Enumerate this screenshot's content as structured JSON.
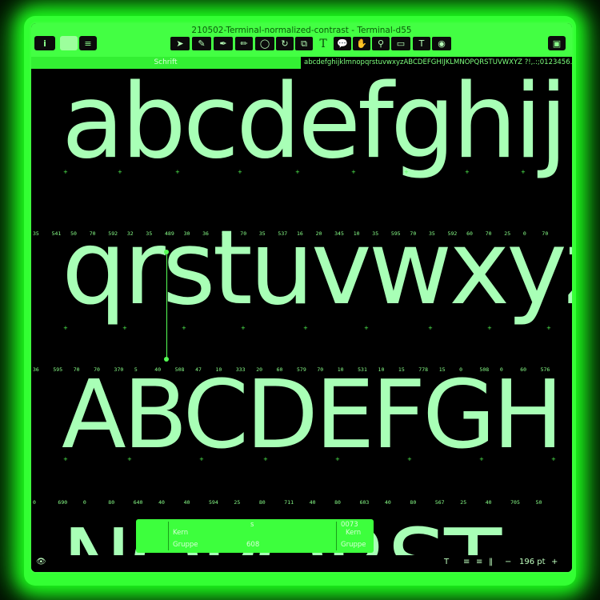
{
  "window": {
    "title": "210502-Terminal-normalized-contrast - Terminal-d55"
  },
  "toolbar": {
    "info_label": "i",
    "list_icon": "list-icon",
    "tools": [
      "pointer-icon",
      "eraser-icon",
      "pen-icon",
      "pencil-icon",
      "circle-icon",
      "rotate-icon",
      "scale-icon",
      "text-tool-icon",
      "speech-bubble-icon",
      "hand-icon",
      "magnifier-icon",
      "measure-icon",
      "tt-icon",
      "annotate-icon"
    ],
    "text_tool_label": "T",
    "sidebar_toggle_icon": "sidebar-icon"
  },
  "tabs": {
    "left_label": "Schrift",
    "right_label": "abcdefghijklmnopqrstuvwxyzABCDEFGHIJKLMNOPQRSTUVWXYZ ?!,.:;0123456..."
  },
  "canvas": {
    "line1": "abcdefghij",
    "line2": "qrstuvwxyz",
    "line3": "ABCDEFGH",
    "line4": "NOPQRST",
    "metrics1": [
      "35",
      "541",
      "50",
      "70",
      "592",
      "32",
      "35",
      "489",
      "30",
      "36",
      "595",
      "70",
      "35",
      "537",
      "16",
      "20",
      "345",
      "10",
      "35",
      "595",
      "70",
      "35",
      "592",
      "60",
      "70",
      "25",
      "0",
      "70"
    ],
    "metrics2": [
      "36",
      "595",
      "70",
      "70",
      "370",
      "5",
      "40",
      "508",
      "47",
      "10",
      "333",
      "20",
      "60",
      "579",
      "70",
      "10",
      "531",
      "10",
      "15",
      "778",
      "15",
      "0",
      "508",
      "0",
      "60",
      "576"
    ],
    "metrics3": [
      "0",
      "690",
      "0",
      "80",
      "640",
      "40",
      "40",
      "594",
      "25",
      "80",
      "711",
      "40",
      "80",
      "603",
      "40",
      "80",
      "567",
      "25",
      "40",
      "705",
      "50"
    ]
  },
  "info_panel": {
    "kern_left": "Kern",
    "group_left": "Gruppe",
    "glyph_name": "s",
    "glyph_value": "608",
    "unicode": "0073",
    "kern_right": "Kern",
    "group_right": "Gruppe"
  },
  "bottom": {
    "eye_icon": "eye-icon",
    "size": "196 pt",
    "minus": "−",
    "plus": "+"
  },
  "colors": {
    "accent": "#3dff3d",
    "glyph": "#a8ffb6",
    "background": "#000000"
  }
}
